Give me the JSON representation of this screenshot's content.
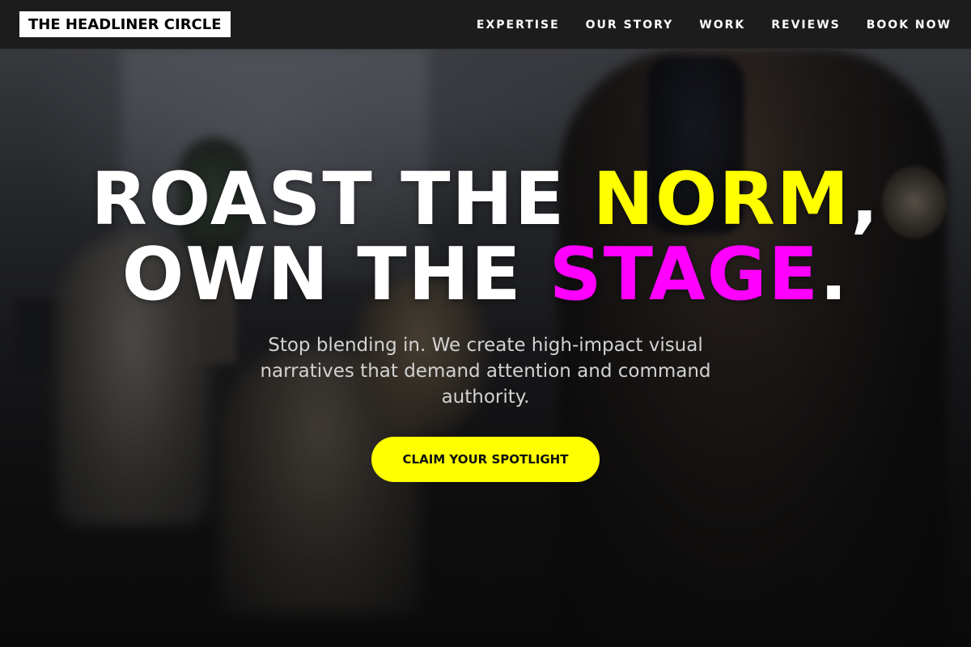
{
  "brand": {
    "logo_text": "THE HEADLINER CIRCLE"
  },
  "nav": {
    "items": [
      {
        "label": "EXPERTISE"
      },
      {
        "label": "OUR STORY"
      },
      {
        "label": "WORK"
      },
      {
        "label": "REVIEWS"
      },
      {
        "label": "BOOK NOW"
      }
    ]
  },
  "hero": {
    "headline_line1_white": "ROAST THE ",
    "headline_line1_accent": "NORM",
    "headline_line1_end": ",",
    "headline_line2_white": "OWN THE ",
    "headline_line2_accent": "STAGE",
    "headline_line2_end": ".",
    "subtitle": "Stop blending in. We create high-impact visual narratives that demand attention and command authority.",
    "cta_label": "CLAIM YOUR SPOTLIGHT",
    "background_image": "blurred film crew with camera operator in a room"
  },
  "colors": {
    "accent_yellow": "#ffff00",
    "accent_magenta": "#ff00ff",
    "header_bg": "#1c1c1c",
    "text_white": "#ffffff"
  }
}
